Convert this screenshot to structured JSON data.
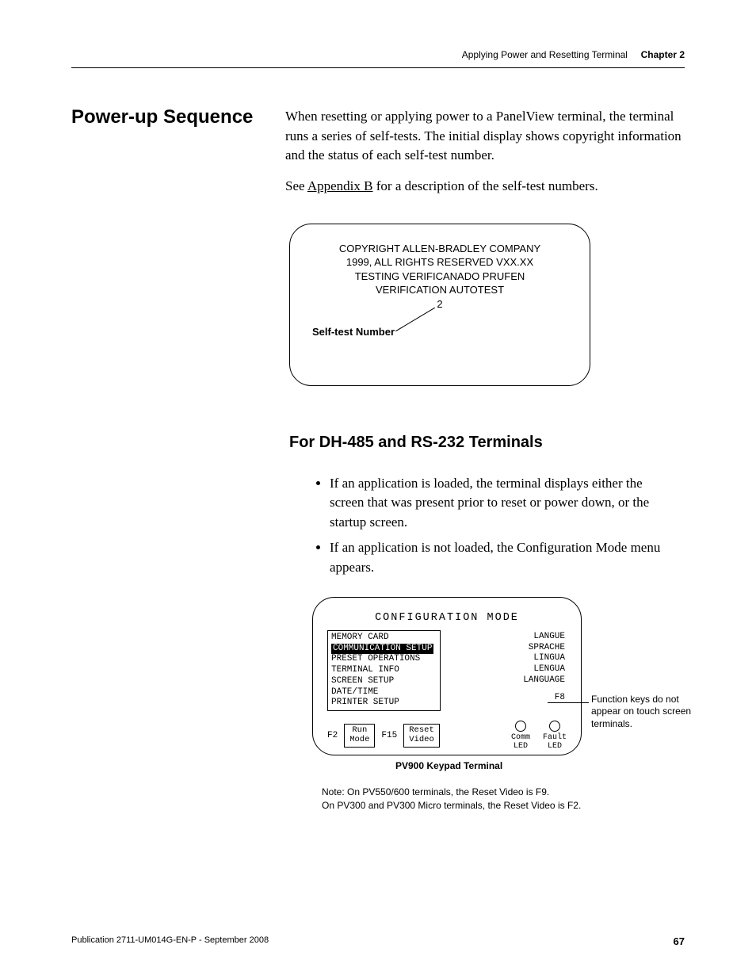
{
  "header": {
    "section": "Applying Power and Resetting Terminal",
    "chapter": "Chapter 2"
  },
  "heading": "Power-up Sequence",
  "paragraphs": {
    "p1": "When resetting or applying power to a PanelView terminal, the terminal runs a series of self-tests. The initial display shows copyright information and the status of each self-test number.",
    "p2a": "See ",
    "p2_link": "Appendix B",
    "p2b": " for a description of the self-test numbers."
  },
  "screen1": {
    "l1": "COPYRIGHT ALLEN-BRADLEY COMPANY",
    "l2": "1999, ALL RIGHTS RESERVED VXX.XX",
    "l3": "TESTING VERIFICANADO PRUFEN",
    "l4": "VERIFICATION AUTOTEST",
    "l5": "2",
    "label": "Self-test Number"
  },
  "subheading": "For DH-485 and RS-232 Terminals",
  "bullets": {
    "b1": "If an application is loaded, the terminal displays either the screen that was present prior to reset or power down, or the startup screen.",
    "b2": "If an application is not loaded, the Configuration Mode menu appears."
  },
  "config": {
    "title": "CONFIGURATION MODE",
    "menu": {
      "m1": "MEMORY CARD",
      "m2": "COMMUNICATION SETUP",
      "m3": "PRESET OPERATIONS",
      "m4": "TERMINAL INFO",
      "m5": "SCREEN SETUP",
      "m6": "DATE/TIME",
      "m7": "PRINTER SETUP"
    },
    "lang": {
      "l1": "LANGUE",
      "l2": "SPRACHE",
      "l3": "LINGUA",
      "l4": "LENGUA",
      "l5": "LANGUAGE",
      "f8": "F8"
    },
    "buttons": {
      "f2": "F2",
      "run1": "Run",
      "run2": "Mode",
      "f15": "F15",
      "rv1": "Reset",
      "rv2": "Video"
    },
    "leds": {
      "c1": "Comm",
      "c2": "LED",
      "f1": "Fault",
      "f2": "LED"
    },
    "side_note": "Function keys do not appear on touch screen terminals.",
    "caption": "PV900 Keypad Terminal"
  },
  "note": {
    "n1": "Note: On PV550/600 terminals, the Reset Video is F9.",
    "n2": "On PV300 and PV300 Micro terminals, the Reset Video is F2."
  },
  "footer": {
    "pub": "Publication 2711-UM014G-EN-P - September 2008",
    "page": "67"
  }
}
